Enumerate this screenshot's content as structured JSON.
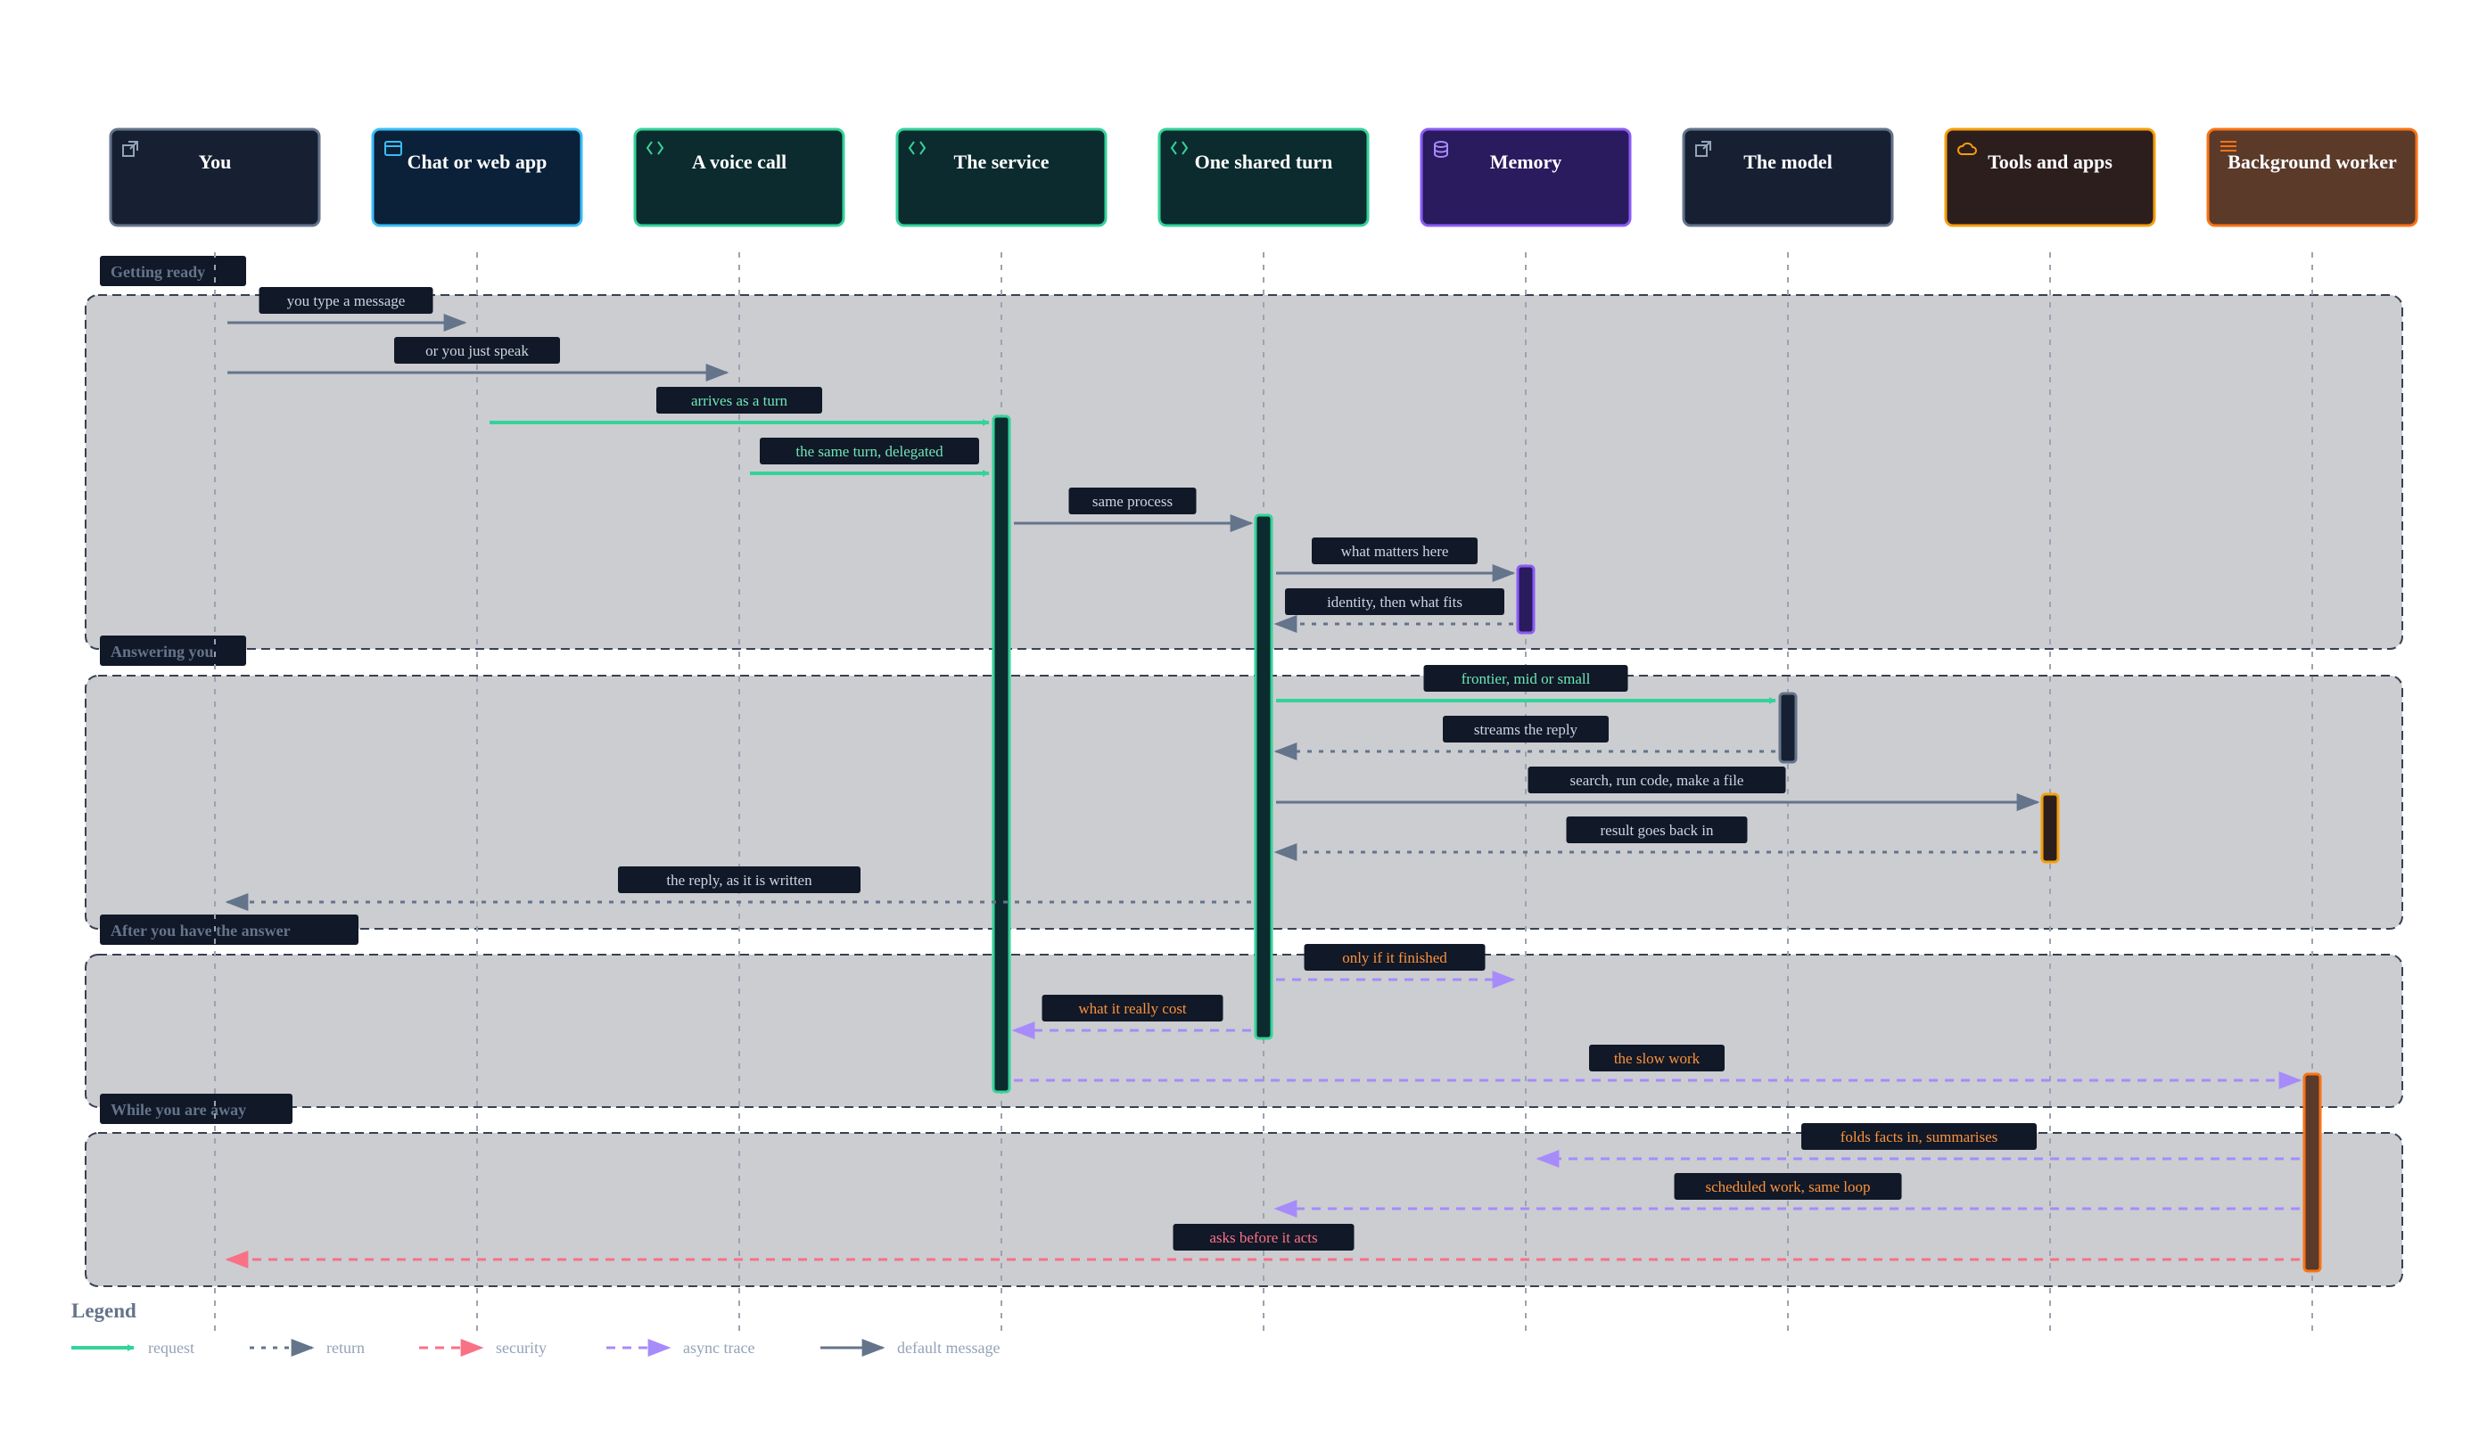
{
  "colors": {
    "request": "#34d399",
    "return": "#64748b",
    "security": "#f87185",
    "async": "#a78bfa",
    "default": "#64748b",
    "label_bg": "#111827",
    "label_text_request": "#6ee7b7",
    "label_text_default": "#cbd5e1",
    "label_text_async": "#fb923c",
    "label_text_security": "#fb7185",
    "group_fill": "#cbcdd1",
    "group_border": "#374151",
    "group_title_text": "#64748b",
    "lifeline": "#9ca3af"
  },
  "participants": [
    {
      "id": "you",
      "label": "You",
      "icon": "external-link-icon",
      "fill": "#172033",
      "border": "#64748b",
      "icon_color": "#94a3b8"
    },
    {
      "id": "chat",
      "label": "Chat or web app",
      "icon": "browser-window-icon",
      "fill": "#0b2139",
      "border": "#38bdf8",
      "icon_color": "#38bdf8"
    },
    {
      "id": "voice",
      "label": "A voice call",
      "icon": "code-brackets-icon",
      "fill": "#0b2b2e",
      "border": "#34d399",
      "icon_color": "#34d399"
    },
    {
      "id": "service",
      "label": "The service",
      "icon": "code-brackets-icon",
      "fill": "#0b2b2e",
      "border": "#34d399",
      "icon_color": "#34d399"
    },
    {
      "id": "turn",
      "label": "One shared turn",
      "icon": "code-brackets-icon",
      "fill": "#0b2b2e",
      "border": "#34d399",
      "icon_color": "#34d399"
    },
    {
      "id": "memory",
      "label": "Memory",
      "icon": "database-icon",
      "fill": "#2a1a5e",
      "border": "#8b5cf6",
      "icon_color": "#a78bfa"
    },
    {
      "id": "model",
      "label": "The model",
      "icon": "external-link-icon",
      "fill": "#172033",
      "border": "#64748b",
      "icon_color": "#94a3b8"
    },
    {
      "id": "tools",
      "label": "Tools and apps",
      "icon": "cloud-icon",
      "fill": "#2d1e1e",
      "border": "#f59e0b",
      "icon_color": "#f59e0b"
    },
    {
      "id": "worker",
      "label": "Background worker",
      "icon": "menu-lines-icon",
      "fill": "#5b3a2a",
      "border": "#f97316",
      "icon_color": "#f97316"
    }
  ],
  "groups": [
    {
      "title": "Getting ready"
    },
    {
      "title": "Answering you"
    },
    {
      "title": "After you have the answer"
    },
    {
      "title": "While you are away"
    }
  ],
  "messages": [
    {
      "from": "you",
      "to": "chat",
      "label": "you type a message",
      "kind": "default"
    },
    {
      "from": "you",
      "to": "voice",
      "label": "or you just speak",
      "kind": "default"
    },
    {
      "from": "chat",
      "to": "service",
      "label": "arrives as a turn",
      "kind": "request"
    },
    {
      "from": "voice",
      "to": "service",
      "label": "the same turn, delegated",
      "kind": "request"
    },
    {
      "from": "service",
      "to": "turn",
      "label": "same process",
      "kind": "default"
    },
    {
      "from": "turn",
      "to": "memory",
      "label": "what matters here",
      "kind": "default"
    },
    {
      "from": "memory",
      "to": "turn",
      "label": "identity, then what fits",
      "kind": "return"
    },
    {
      "from": "turn",
      "to": "model",
      "label": "frontier, mid or small",
      "kind": "request"
    },
    {
      "from": "model",
      "to": "turn",
      "label": "streams the reply",
      "kind": "return"
    },
    {
      "from": "turn",
      "to": "tools",
      "label": "search, run code, make a file",
      "kind": "default"
    },
    {
      "from": "tools",
      "to": "turn",
      "label": "result goes back in",
      "kind": "return"
    },
    {
      "from": "turn",
      "to": "you",
      "label": "the reply, as it is written",
      "kind": "return"
    },
    {
      "from": "turn",
      "to": "memory",
      "label": "only if it finished",
      "kind": "async"
    },
    {
      "from": "turn",
      "to": "service",
      "label": "what it really cost",
      "kind": "async"
    },
    {
      "from": "service",
      "to": "worker",
      "label": "the slow work",
      "kind": "async"
    },
    {
      "from": "worker",
      "to": "memory",
      "label": "folds facts in, summarises",
      "kind": "async"
    },
    {
      "from": "worker",
      "to": "turn",
      "label": "scheduled work, same loop",
      "kind": "async"
    },
    {
      "from": "worker",
      "to": "you",
      "label": "asks before it acts",
      "kind": "security"
    }
  ],
  "activations": [
    {
      "on": "service",
      "fill": "#0b2b2e",
      "border": "#34d399"
    },
    {
      "on": "turn",
      "fill": "#0b2b2e",
      "border": "#34d399"
    },
    {
      "on": "memory",
      "fill": "#2a1a5e",
      "border": "#8b5cf6"
    },
    {
      "on": "model",
      "fill": "#172033",
      "border": "#64748b"
    },
    {
      "on": "tools",
      "fill": "#2d1e1e",
      "border": "#f59e0b"
    },
    {
      "on": "worker",
      "fill": "#5b3a2a",
      "border": "#f97316"
    }
  ],
  "legend": {
    "title": "Legend",
    "items": [
      {
        "label": "request",
        "kind": "request"
      },
      {
        "label": "return",
        "kind": "return"
      },
      {
        "label": "security",
        "kind": "security"
      },
      {
        "label": "async trace",
        "kind": "async"
      },
      {
        "label": "default message",
        "kind": "default"
      }
    ]
  }
}
